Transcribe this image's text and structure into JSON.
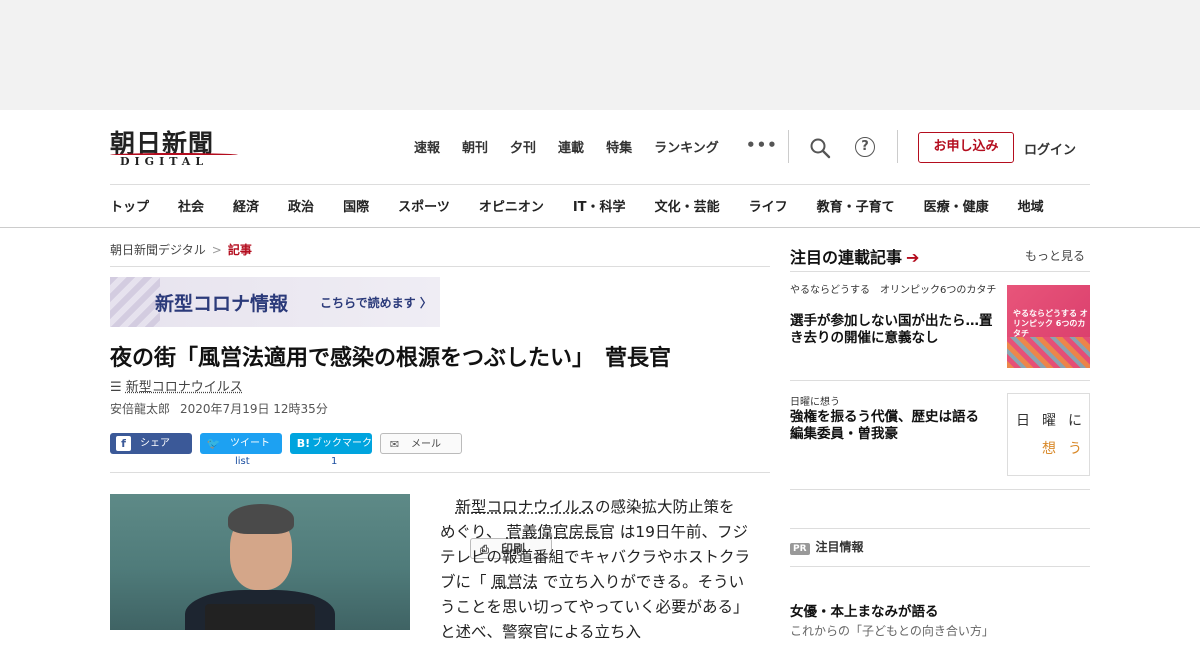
{
  "header": {
    "logo_jp": "朝日新聞",
    "logo_en": "DIGITAL",
    "topnav": [
      "速報",
      "朝刊",
      "夕刊",
      "連載",
      "特集",
      "ランキング"
    ],
    "more": "•••",
    "help": "?",
    "apply_label": "お申し込み",
    "login_label": "ログイン",
    "categories": [
      "トップ",
      "社会",
      "経済",
      "政治",
      "国際",
      "スポーツ",
      "オピニオン",
      "IT・科学",
      "文化・芸能",
      "ライフ",
      "教育・子育て",
      "医療・健康",
      "地域"
    ]
  },
  "breadcrumb": {
    "home": "朝日新聞デジタル",
    "sep": ">",
    "current": "記事"
  },
  "covid_banner": {
    "title": "新型コロナ情報",
    "cta": "こちらで読めます 〉"
  },
  "article": {
    "headline": "夜の街「風営法適用で感染の根源をつぶしたい」　菅長官",
    "tag_icon": "☰",
    "tag": "新型コロナウイルス",
    "author": "安倍龍太郎",
    "date": "2020年7月19日 12時35分",
    "share": {
      "facebook": "シェア",
      "twitter": "ツイート",
      "hatena": "ブックマーク",
      "mail": "メール",
      "print": "印刷",
      "twitter_count": "list",
      "hatena_count": "1"
    },
    "body": {
      "p1": "新型コロナウイルス",
      "p2": "の感染拡大防止策をめぐり、",
      "p3": "菅義偉官房長官",
      "p4": "は19日午前、フジテレビの報道番組でキャバクラやホストクラブに「",
      "p5": "風営法",
      "p6": "で立ち入りができる。そういうことを思い切ってやっていく必要がある」と述べ、警察官による立ち入"
    }
  },
  "sidebar": {
    "title": "注目の連載記事",
    "arrow": "➔",
    "more": "もっと見る",
    "item1_series": "やるならどうする　オリンピック6つのカタチ",
    "item1_head": "選手が参加しない国が出たら…置き去りの開催に意義なし",
    "thumb1_text": "やるならどうする オリンピック 6つのカタチ",
    "item2_series": "日曜に想う",
    "item2_head": "強権を振るう代償、歴史は語る　編集委員・曽我豪",
    "thumb2_chars": [
      "日",
      "曜",
      "に",
      "想",
      "う"
    ],
    "pr_badge": "PR",
    "pr_label": "注目情報",
    "pr_head": "女優・本上まなみが語る",
    "pr_sub": "これからの「子どもとの向き合い方」"
  },
  "colors": {
    "brand": "#b40d1e",
    "facebook": "#3b5998",
    "twitter": "#1da1f2",
    "hatena": "#00a4de"
  }
}
